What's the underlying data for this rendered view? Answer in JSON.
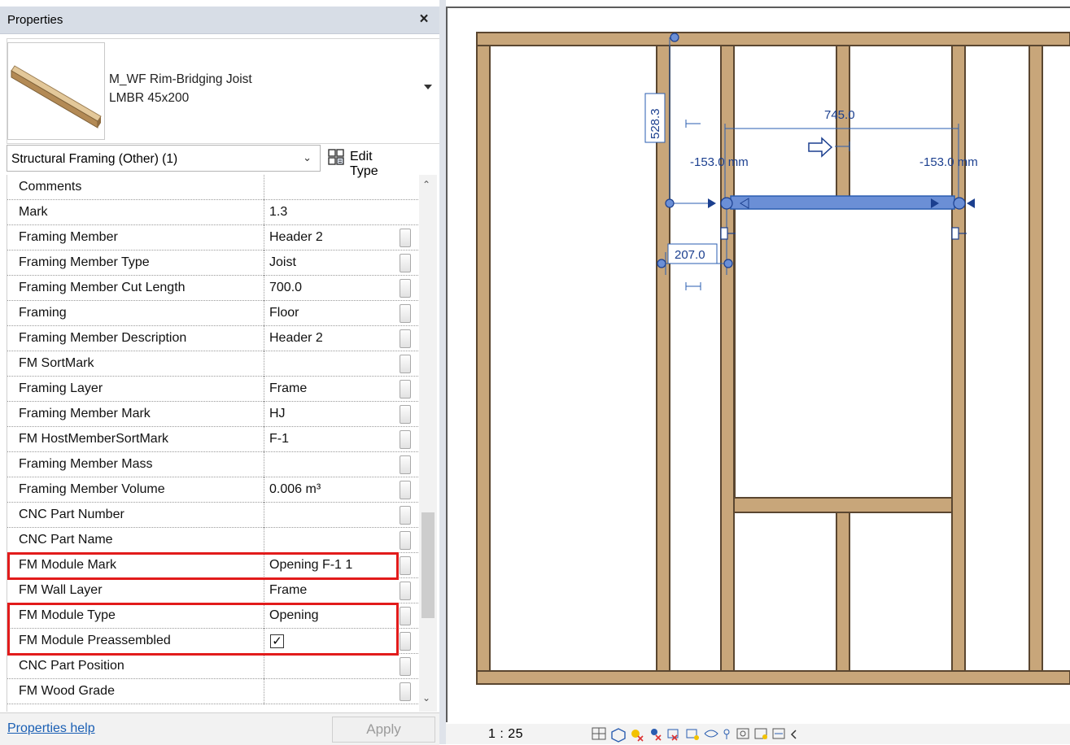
{
  "panel": {
    "title": "Properties",
    "close_glyph": "×",
    "type_name_line1": "M_WF Rim-Bridging Joist",
    "type_name_line2": "LMBR 45x200",
    "preview_icon": "beam-preview-icon",
    "filter": "Structural Framing (Other) (1)",
    "edit_type_label": "Edit Type",
    "help_link": "Properties help",
    "apply_label": "Apply"
  },
  "parameters": [
    {
      "name": "Comments",
      "value": "",
      "button": false
    },
    {
      "name": "Mark",
      "value": "1.3",
      "button": false
    },
    {
      "name": "Framing Member",
      "value": "Header 2",
      "button": true
    },
    {
      "name": "Framing Member Type",
      "value": "Joist",
      "button": true
    },
    {
      "name": "Framing Member Cut Length",
      "value": "700.0",
      "button": true
    },
    {
      "name": "Framing",
      "value": "Floor",
      "button": true
    },
    {
      "name": "Framing Member Description",
      "value": "Header 2",
      "button": true
    },
    {
      "name": "FM SortMark",
      "value": "",
      "button": true
    },
    {
      "name": "Framing Layer",
      "value": "Frame",
      "button": true
    },
    {
      "name": "Framing Member Mark",
      "value": "HJ",
      "button": true
    },
    {
      "name": "FM HostMemberSortMark",
      "value": "F-1",
      "button": true
    },
    {
      "name": "Framing Member Mass",
      "value": "",
      "button": true
    },
    {
      "name": "Framing Member Volume",
      "value": "0.006 m³",
      "button": true
    },
    {
      "name": "CNC Part Number",
      "value": "",
      "button": true
    },
    {
      "name": "CNC Part Name",
      "value": "",
      "button": true
    },
    {
      "name": "FM Module Mark",
      "value": "Opening F-1  1",
      "button": true
    },
    {
      "name": "FM Wall Layer",
      "value": "Frame",
      "button": true
    },
    {
      "name": "FM Module Type",
      "value": "Opening",
      "button": true
    },
    {
      "name": "FM Module Preassembled",
      "value": "✓",
      "button": true,
      "checkbox": true
    },
    {
      "name": "CNC Part Position",
      "value": "",
      "button": true
    },
    {
      "name": "FM Wood Grade",
      "value": "",
      "button": true
    }
  ],
  "drawing": {
    "dim_vertical": "528.3",
    "dim_width": "745.0",
    "dim_offset_left": "-153.0 mm",
    "dim_offset_right": "-153.0 mm",
    "dim_small": "207.0",
    "scale": "1 : 25",
    "colors": {
      "wood": "#c8a67a",
      "wood_edge": "#5a4630",
      "dim": "#2a5db0",
      "joist": "#6b8fd6",
      "highlight": "#e21b1b"
    }
  }
}
